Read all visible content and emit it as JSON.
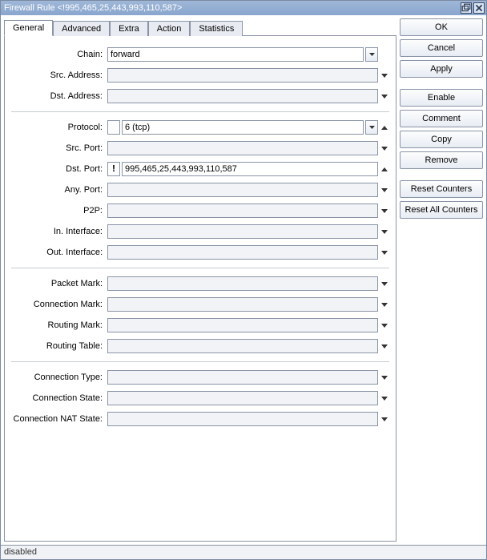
{
  "window": {
    "title": "Firewall Rule <!995,465,25,443,993,110,587>"
  },
  "tabs": {
    "general": "General",
    "advanced": "Advanced",
    "extra": "Extra",
    "action": "Action",
    "statistics": "Statistics"
  },
  "labels": {
    "chain": "Chain:",
    "src_address": "Src. Address:",
    "dst_address": "Dst. Address:",
    "protocol": "Protocol:",
    "src_port": "Src. Port:",
    "dst_port": "Dst. Port:",
    "any_port": "Any. Port:",
    "p2p": "P2P:",
    "in_interface": "In. Interface:",
    "out_interface": "Out. Interface:",
    "packet_mark": "Packet Mark:",
    "connection_mark": "Connection Mark:",
    "routing_mark": "Routing Mark:",
    "routing_table": "Routing Table:",
    "connection_type": "Connection Type:",
    "connection_state": "Connection State:",
    "connection_nat_state": "Connection NAT State:"
  },
  "fields": {
    "chain": {
      "value": "forward",
      "neg": "",
      "tri": "none"
    },
    "src_address": {
      "value": "",
      "neg": "none",
      "tri": "down"
    },
    "dst_address": {
      "value": "",
      "neg": "none",
      "tri": "down"
    },
    "protocol": {
      "value": "6 (tcp)",
      "neg": "",
      "tri": "up"
    },
    "src_port": {
      "value": "",
      "neg": "none",
      "tri": "down"
    },
    "dst_port": {
      "value": "995,465,25,443,993,110,587",
      "neg": "!",
      "tri": "up"
    },
    "any_port": {
      "value": "",
      "neg": "none",
      "tri": "down"
    },
    "p2p": {
      "value": "",
      "neg": "none",
      "tri": "down"
    },
    "in_interface": {
      "value": "",
      "neg": "none",
      "tri": "down"
    },
    "out_interface": {
      "value": "",
      "neg": "none",
      "tri": "down"
    },
    "packet_mark": {
      "value": "",
      "neg": "none",
      "tri": "down"
    },
    "connection_mark": {
      "value": "",
      "neg": "none",
      "tri": "down"
    },
    "routing_mark": {
      "value": "",
      "neg": "none",
      "tri": "down"
    },
    "routing_table": {
      "value": "",
      "neg": "none",
      "tri": "down"
    },
    "connection_type": {
      "value": "",
      "neg": "none",
      "tri": "down"
    },
    "connection_state": {
      "value": "",
      "neg": "none",
      "tri": "down"
    },
    "connection_nat_state": {
      "value": "",
      "neg": "none",
      "tri": "down"
    }
  },
  "buttons": {
    "ok": "OK",
    "cancel": "Cancel",
    "apply": "Apply",
    "enable": "Enable",
    "comment": "Comment",
    "copy": "Copy",
    "remove": "Remove",
    "reset_counters": "Reset Counters",
    "reset_all_counters": "Reset All Counters"
  },
  "status": "disabled"
}
